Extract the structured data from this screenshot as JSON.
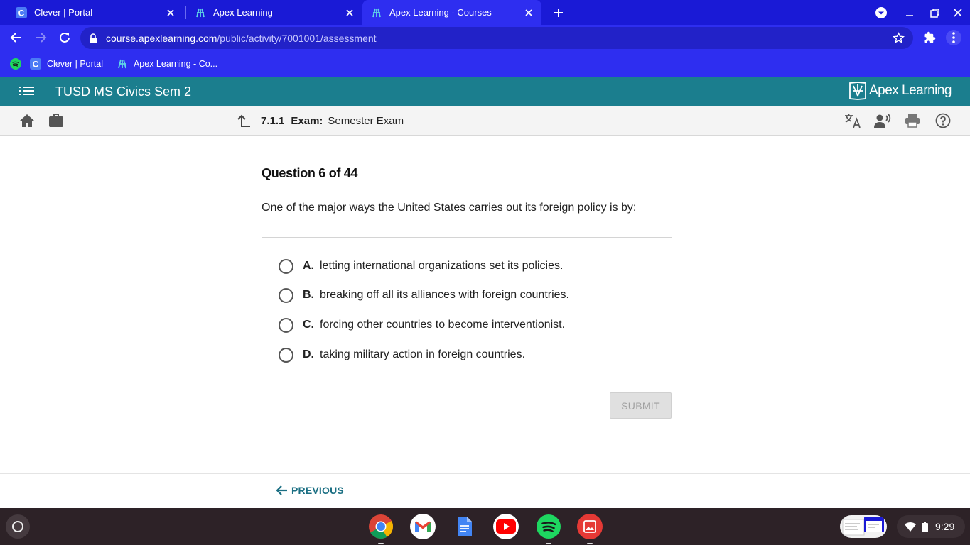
{
  "browser": {
    "tabs": [
      {
        "title": "Clever | Portal",
        "icon": "clever-icon"
      },
      {
        "title": "Apex Learning",
        "icon": "apex-icon"
      },
      {
        "title": "Apex Learning - Courses",
        "icon": "apex-icon",
        "active": true
      }
    ],
    "url_host": "course.apexlearning.com",
    "url_path": "/public/activity/7001001/assessment",
    "bookmarks": [
      {
        "title": "",
        "icon": "spotify-icon"
      },
      {
        "title": "Clever | Portal",
        "icon": "clever-icon"
      },
      {
        "title": "Apex Learning - Co...",
        "icon": "apex-icon"
      }
    ],
    "colors": {
      "tabstrip": "#1a1ad6",
      "toolbar": "#2e2ef0"
    }
  },
  "header": {
    "course": "TUSD MS Civics Sem 2",
    "logo": "Apex Learning",
    "color": "#1b7e8e"
  },
  "activity": {
    "number": "7.1.1",
    "type": "Exam:",
    "name": "Semester Exam"
  },
  "question": {
    "heading": "Question 6 of 44",
    "prompt": "One of the major ways the United States carries out its foreign policy is by:",
    "choices": [
      {
        "letter": "A.",
        "text": "letting international organizations set its policies."
      },
      {
        "letter": "B.",
        "text": "breaking off all its alliances with foreign countries."
      },
      {
        "letter": "C.",
        "text": "forcing other countries to become interventionist."
      },
      {
        "letter": "D.",
        "text": "taking military action in foreign countries."
      }
    ],
    "submit_label": "SUBMIT"
  },
  "footer": {
    "previous_label": "PREVIOUS"
  },
  "shelf": {
    "apps": [
      "chrome-icon",
      "gmail-icon",
      "docs-icon",
      "youtube-icon",
      "spotify-icon",
      "gallery-icon"
    ],
    "time": "9:29"
  }
}
